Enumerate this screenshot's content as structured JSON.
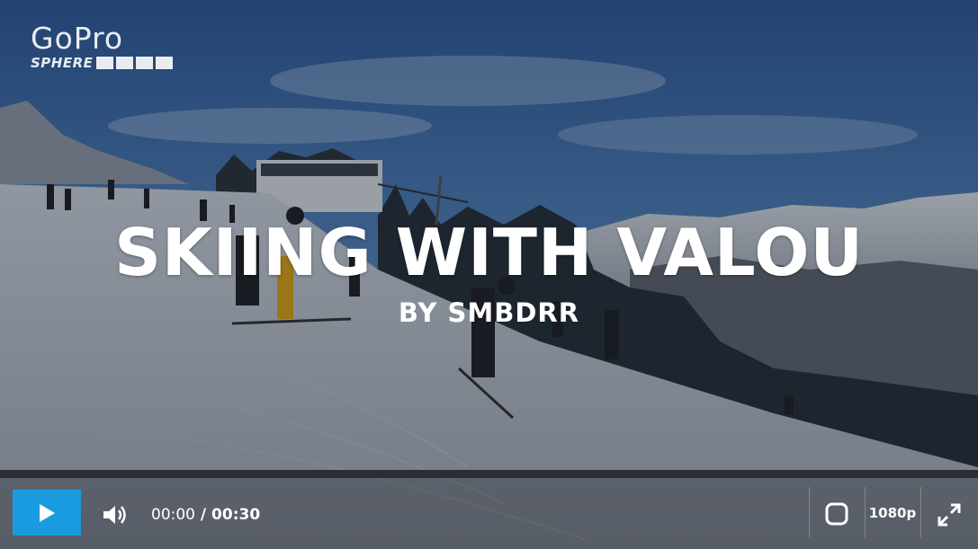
{
  "brand": {
    "logo_word": "GoPro",
    "logo_sub": "SPHERE"
  },
  "video": {
    "title": "SKIING WITH VALOU",
    "byline": "BY SMBDRR",
    "thumbnail_scene": "snowy ski slope with skiers, ski lift station and alpine mountains under blue sky"
  },
  "controls": {
    "current_time": "00:00",
    "separator": " / ",
    "duration": "00:30",
    "quality_label": "1080p",
    "progress_fraction": 0,
    "accent_color": "#1a9be0",
    "icons": {
      "play": "play-icon",
      "volume": "volume-icon",
      "vr": "vr-headset-icon",
      "fullscreen": "fullscreen-icon"
    }
  }
}
